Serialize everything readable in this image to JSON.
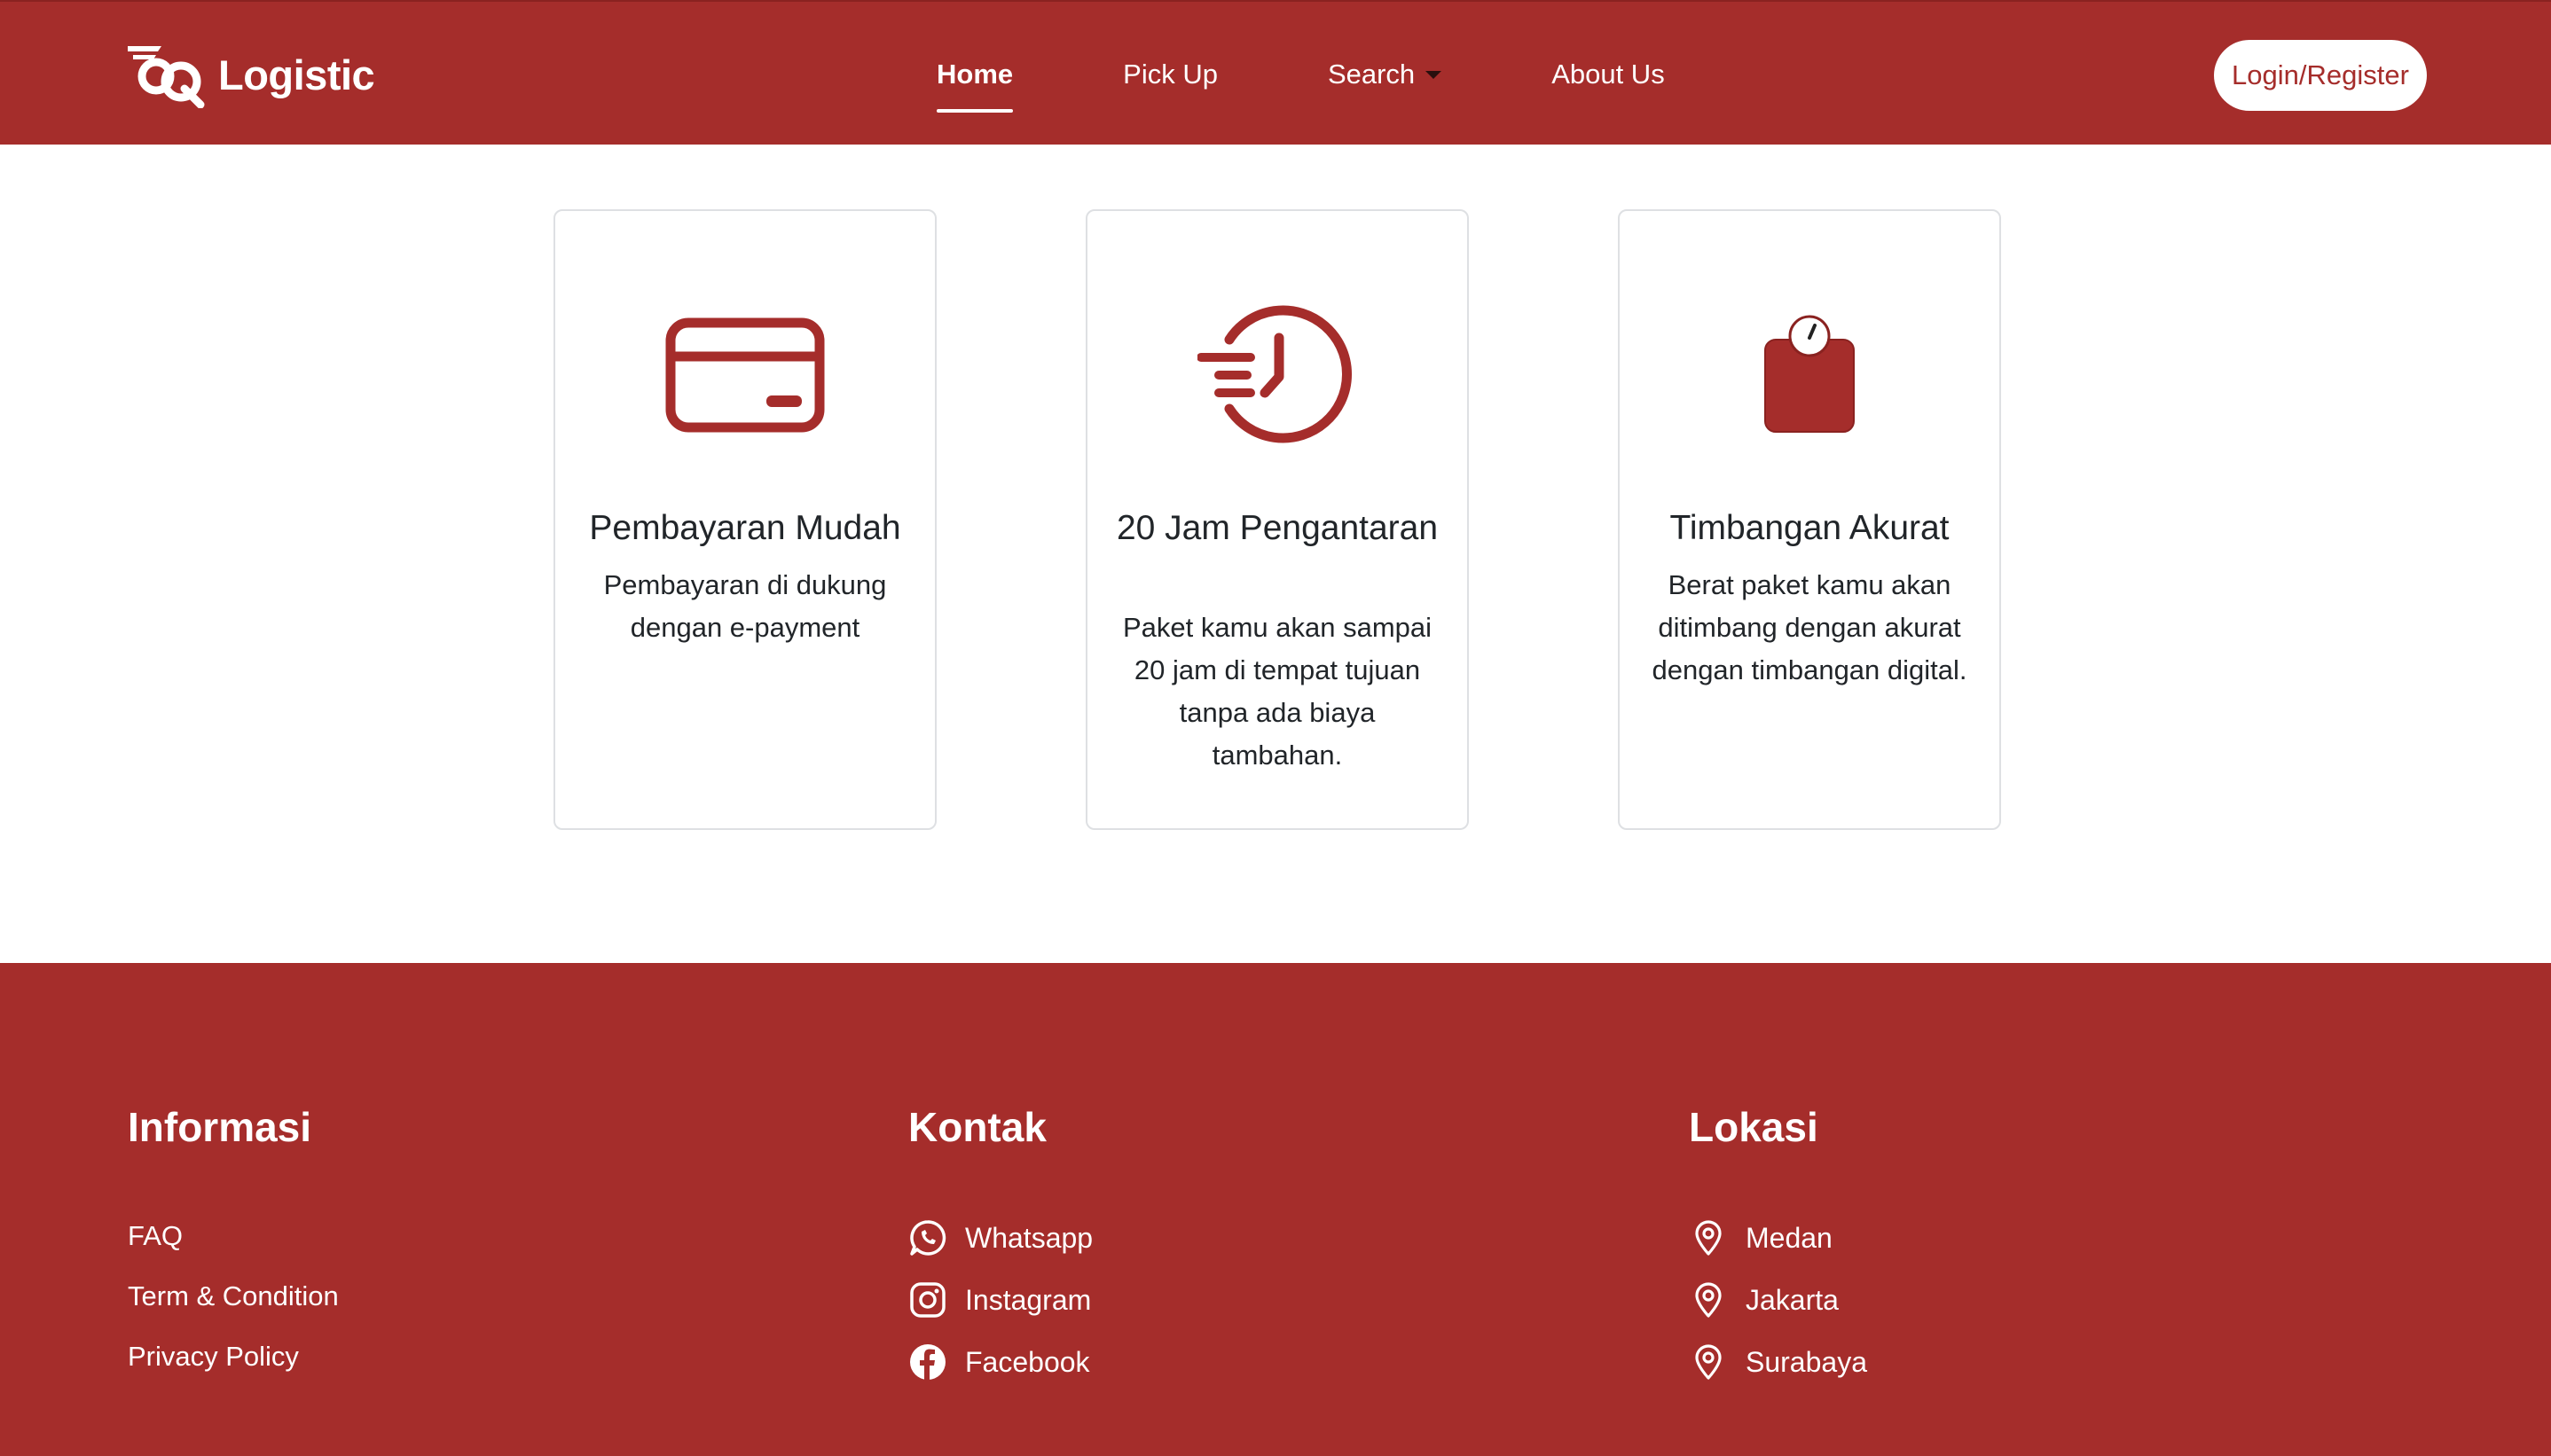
{
  "brand": {
    "name": "Logistic"
  },
  "nav": {
    "items": [
      {
        "label": "Home"
      },
      {
        "label": "Pick Up"
      },
      {
        "label": "Search"
      },
      {
        "label": "About Us"
      }
    ],
    "login_label": "Login/Register"
  },
  "features": [
    {
      "icon": "credit-card-icon",
      "title": "Pembayaran Mudah",
      "description": "Pembayaran di dukung dengan e-payment"
    },
    {
      "icon": "fast-clock-icon",
      "title": "20 Jam Pengantaran",
      "description": "Paket kamu akan sampai 20 jam di tempat tujuan tanpa ada biaya tambahan."
    },
    {
      "icon": "weighing-scale-icon",
      "title": "Timbangan Akurat",
      "description": "Berat paket kamu akan ditimbang dengan akurat dengan timbangan digital."
    }
  ],
  "footer": {
    "informasi": {
      "title": "Informasi",
      "links": [
        "FAQ",
        "Term & Condition",
        "Privacy Policy"
      ]
    },
    "kontak": {
      "title": "Kontak",
      "items": [
        {
          "label": "Whatsapp",
          "icon": "whatsapp-icon"
        },
        {
          "label": "Instagram",
          "icon": "instagram-icon"
        },
        {
          "label": "Facebook",
          "icon": "facebook-icon"
        }
      ]
    },
    "lokasi": {
      "title": "Lokasi",
      "items": [
        {
          "label": "Medan",
          "icon": "location-pin-icon"
        },
        {
          "label": "Jakarta",
          "icon": "location-pin-icon"
        },
        {
          "label": "Surabaya",
          "icon": "location-pin-icon"
        }
      ]
    }
  },
  "colors": {
    "brand_red": "#a52d2b",
    "white": "#ffffff",
    "text_dark": "#212529",
    "card_border": "#dee0e3"
  }
}
